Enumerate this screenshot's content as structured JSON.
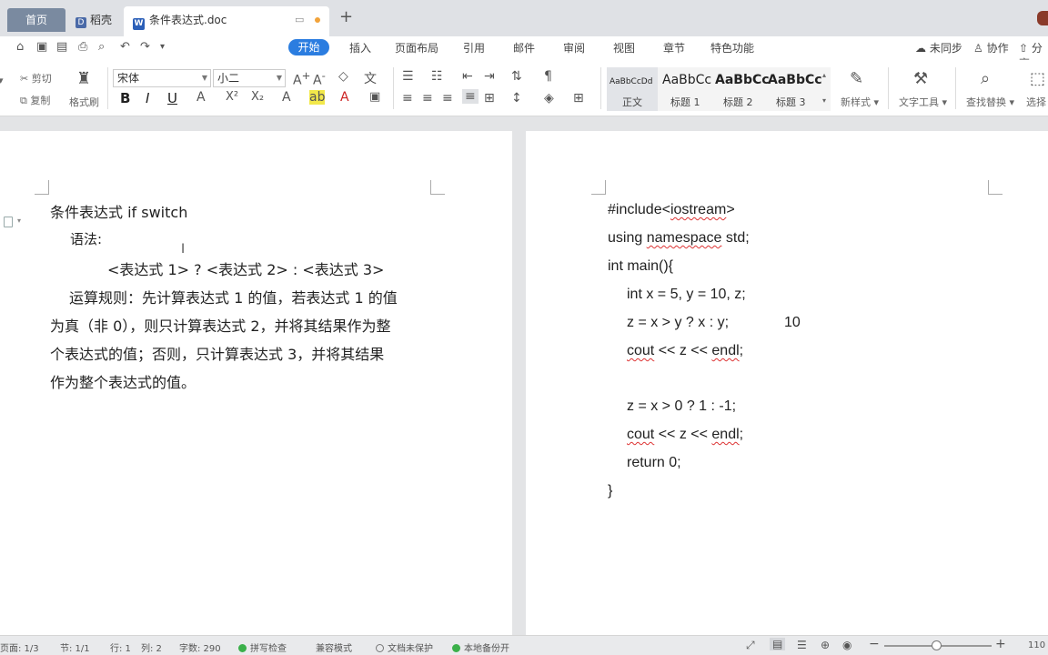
{
  "tabs": {
    "home": "首页",
    "daoke": "稻壳",
    "doc_title": "条件表达式.doc",
    "doc_badge": "W",
    "daoke_badge": "D",
    "new_tab": "+"
  },
  "menu": {
    "active": "开始",
    "items": [
      "插入",
      "页面布局",
      "引用",
      "邮件",
      "审阅",
      "视图",
      "章节",
      "特色功能"
    ],
    "right": [
      "未同步",
      "协作",
      "分享"
    ]
  },
  "ribbon": {
    "cut": "剪切",
    "copy": "复制",
    "format_painter": "格式刷",
    "font_name": "宋体",
    "font_size": "小二",
    "bold": "B",
    "italic": "I",
    "underline": "U",
    "styles": [
      {
        "preview": "AaBbCcDd",
        "label": "正文"
      },
      {
        "preview": "AaBbCc",
        "label": "标题 1"
      },
      {
        "preview": "AaBbCc",
        "label": "标题 2"
      },
      {
        "preview": "AaBbCc",
        "label": "标题 3"
      }
    ],
    "new_style": "新样式",
    "text_tools": "文字工具",
    "find_replace": "查找替换",
    "select": "选择"
  },
  "left_page": {
    "title_line": "条件表达式    if switch",
    "syntax_label": "语法:",
    "syntax": "<表达式 1> ? <表达式 2> : <表达式 3>",
    "rule_lines": [
      "运算规则：先计算表达式 1 的值，若表达式 1 的值",
      "为真（非 0），则只计算表达式 2，并将其结果作为整",
      "个表达式的值；否则，只计算表达式 3，并将其结果",
      "作为整个表达式的值。"
    ]
  },
  "right_page": {
    "code": {
      "l1a": "#include<",
      "l1b": "iostream",
      "l1c": ">",
      "l2a": "using ",
      "l2b": "namespace",
      "l2c": " std;",
      "l3": "int main(){",
      "l4": "int x = 5, y = 10, z;",
      "l5": "z = x > y ? x : y;",
      "l5_note": "10",
      "l6a": "cout",
      "l6b": " << z << ",
      "l6c": "endl",
      "l6d": ";",
      "l7": "z = x > 0 ? 1 : -1;",
      "l8a": "cout",
      "l8b": " << z << ",
      "l8c": "endl",
      "l8d": ";",
      "l9": "return 0;",
      "l10": "}"
    }
  },
  "status": {
    "page": "页面: 1/3",
    "section": "节: 1/1",
    "row": "行: 1",
    "col": "列: 2",
    "words": "字数: 290",
    "spell": "拼写检查",
    "compat": "兼容模式",
    "unprotected": "文档未保护",
    "backup": "本地备份开",
    "zoom": "110"
  },
  "colors": {
    "accent": "#2b7de0",
    "home_tab": "#7a8aa0",
    "status_green": "#3bb04a"
  }
}
